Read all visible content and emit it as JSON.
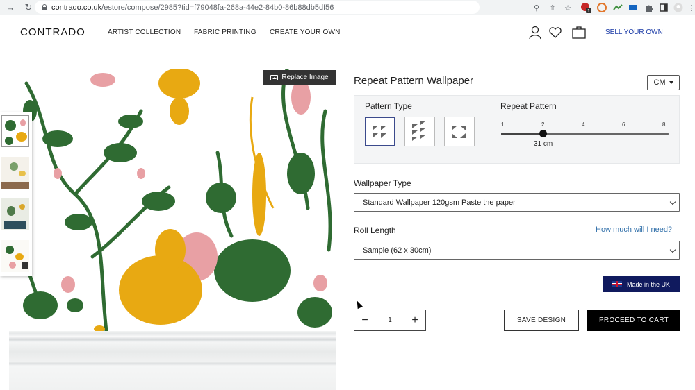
{
  "browser": {
    "url_host": "contrado.co.uk",
    "url_path": "/estore/compose/2985?tid=f79048fa-268a-44e2-84b0-86b88db5df56",
    "ext_badge_count": "1"
  },
  "header": {
    "logo": "CONTRADO",
    "nav": [
      "ARTIST COLLECTION",
      "FABRIC PRINTING",
      "CREATE YOUR OWN"
    ],
    "sell_link": "SELL YOUR OWN"
  },
  "preview": {
    "replace_label": "Replace Image",
    "colors": {
      "green": "#2f6b32",
      "yellow": "#e8a912",
      "pink": "#e8a0a4"
    }
  },
  "product": {
    "title": "Repeat Pattern Wallpaper",
    "unit": "CM",
    "pattern_type_label": "Pattern Type",
    "repeat_pattern_label": "Repeat Pattern",
    "repeat_ticks": [
      "1",
      "2",
      "4",
      "6",
      "8"
    ],
    "repeat_value": "31 cm",
    "repeat_level": 2,
    "wallpaper_type_label": "Wallpaper Type",
    "wallpaper_type_value": "Standard Wallpaper 120gsm Paste the paper",
    "roll_length_label": "Roll Length",
    "help_link": "How much will I need?",
    "roll_length_value": "Sample (62 x 30cm)",
    "badge": "Made in the UK",
    "quantity": "1",
    "save_label": "SAVE DESIGN",
    "cart_label": "PROCEED TO CART"
  }
}
